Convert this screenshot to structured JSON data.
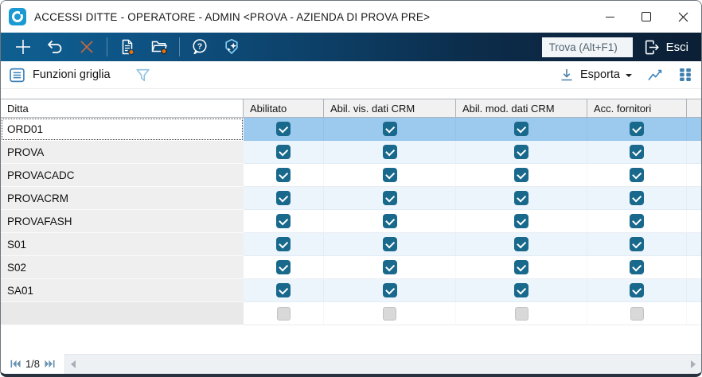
{
  "window": {
    "title": "ACCESSI DITTE - OPERATORE - ADMIN <PROVA - AZIENDA DI PROVA PRE>"
  },
  "toolbar": {
    "find_label": "Trova (Alt+F1)",
    "exit_label": "Esci",
    "icons": [
      "plus-icon",
      "undo-icon",
      "delete-x-icon",
      "document-icon",
      "folder-icon",
      "help-icon",
      "ai-sparkle-icon",
      "exit-icon"
    ]
  },
  "gridbar": {
    "functions_label": "Funzioni griglia",
    "export_label": "Esporta",
    "icons": [
      "list-icon",
      "filter-icon",
      "download-icon",
      "chart-icon",
      "grid-squares-icon"
    ]
  },
  "table": {
    "columns": [
      "Ditta",
      "Abilitato",
      "Abil. vis. dati CRM",
      "Abil. mod. dati CRM",
      "Acc. fornitori"
    ],
    "rows": [
      {
        "ditta": "ORD01",
        "checks": [
          true,
          true,
          true,
          true
        ],
        "state": "selected"
      },
      {
        "ditta": "PROVA",
        "checks": [
          true,
          true,
          true,
          true
        ]
      },
      {
        "ditta": "PROVACADC",
        "checks": [
          true,
          true,
          true,
          true
        ]
      },
      {
        "ditta": "PROVACRM",
        "checks": [
          true,
          true,
          true,
          true
        ]
      },
      {
        "ditta": "PROVAFASH",
        "checks": [
          true,
          true,
          true,
          true
        ]
      },
      {
        "ditta": "S01",
        "checks": [
          true,
          true,
          true,
          true
        ]
      },
      {
        "ditta": "S02",
        "checks": [
          true,
          true,
          true,
          true
        ]
      },
      {
        "ditta": "SA01",
        "checks": [
          true,
          true,
          true,
          true
        ]
      },
      {
        "ditta": "",
        "checks": [
          null,
          null,
          null,
          null
        ],
        "state": "new-row"
      }
    ]
  },
  "statusbar": {
    "page_indicator": "1/8"
  },
  "colors": {
    "toolbar_gradient_left": "#0f5f91",
    "toolbar_gradient_right": "#0b1f35",
    "selection_blue": "#9cc9ee",
    "row_tint_blue": "#edf5fc",
    "checkbox_teal": "#19698c",
    "badge_orange": "#e8700a",
    "app_icon_blue": "#1b9ad2",
    "icon_blue": "#3c82ba"
  }
}
